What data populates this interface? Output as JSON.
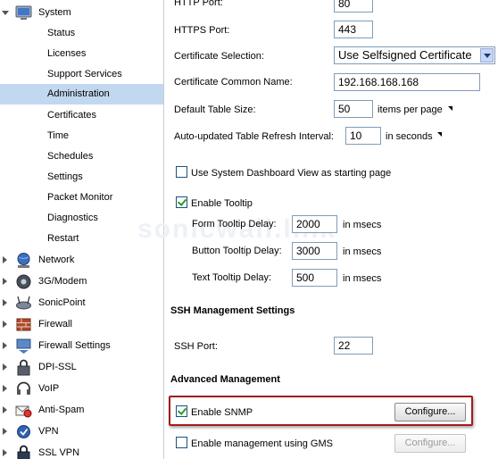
{
  "nav": {
    "system_label": "System",
    "system_sub": [
      "Status",
      "Licenses",
      "Support Services",
      "Administration",
      "Certificates",
      "Time",
      "Schedules",
      "Settings",
      "Packet Monitor",
      "Diagnostics",
      "Restart"
    ],
    "selected_item": "Administration",
    "top_items": [
      {
        "label": "Network",
        "icon": "network-globe-icon"
      },
      {
        "label": "3G/Modem",
        "icon": "modem-icon"
      },
      {
        "label": "SonicPoint",
        "icon": "sonicpoint-icon"
      },
      {
        "label": "Firewall",
        "icon": "firewall-icon"
      },
      {
        "label": "Firewall Settings",
        "icon": "firewall-settings-icon"
      },
      {
        "label": "DPI-SSL",
        "icon": "dpi-ssl-icon"
      },
      {
        "label": "VoIP",
        "icon": "voip-headset-icon"
      },
      {
        "label": "Anti-Spam",
        "icon": "anti-spam-icon"
      },
      {
        "label": "VPN",
        "icon": "vpn-icon"
      },
      {
        "label": "SSL VPN",
        "icon": "ssl-vpn-icon"
      }
    ]
  },
  "admin": {
    "http_port_label": "HTTP Port:",
    "http_port_value": "80",
    "https_port_label": "HTTPS Port:",
    "https_port_value": "443",
    "cert_selection_label": "Certificate Selection:",
    "cert_selection_value": "Use Selfsigned Certificate",
    "cert_common_name_label": "Certificate Common Name:",
    "cert_common_name_value": "192.168.168.168",
    "default_table_size_label": "Default Table Size:",
    "default_table_size_value": "50",
    "default_table_size_unit": "items per page",
    "refresh_interval_label": "Auto-updated Table Refresh Interval:",
    "refresh_interval_value": "10",
    "refresh_interval_unit": "in seconds",
    "dashboard_label": "Use System Dashboard View as starting page",
    "dashboard_checked": false,
    "tooltip_label": "Enable Tooltip",
    "tooltip_checked": true,
    "form_tooltip_label": "Form Tooltip Delay:",
    "form_tooltip_value": "2000",
    "button_tooltip_label": "Button Tooltip Delay:",
    "button_tooltip_value": "3000",
    "text_tooltip_label": "Text Tooltip Delay:",
    "text_tooltip_value": "500",
    "msecs_unit": "in msecs"
  },
  "ssh": {
    "section_title": "SSH Management Settings",
    "port_label": "SSH Port:",
    "port_value": "22"
  },
  "advanced": {
    "section_title": "Advanced Management",
    "snmp_label": "Enable SNMP",
    "snmp_checked": true,
    "snmp_configure_label": "Configure...",
    "gms_label": "Enable management using GMS",
    "gms_checked": false,
    "gms_configure_label": "Configure..."
  },
  "colors": {
    "selected_bg": "#c2d8f0",
    "highlight_border": "#a01d1d",
    "input_border": "#7f9db9"
  }
}
